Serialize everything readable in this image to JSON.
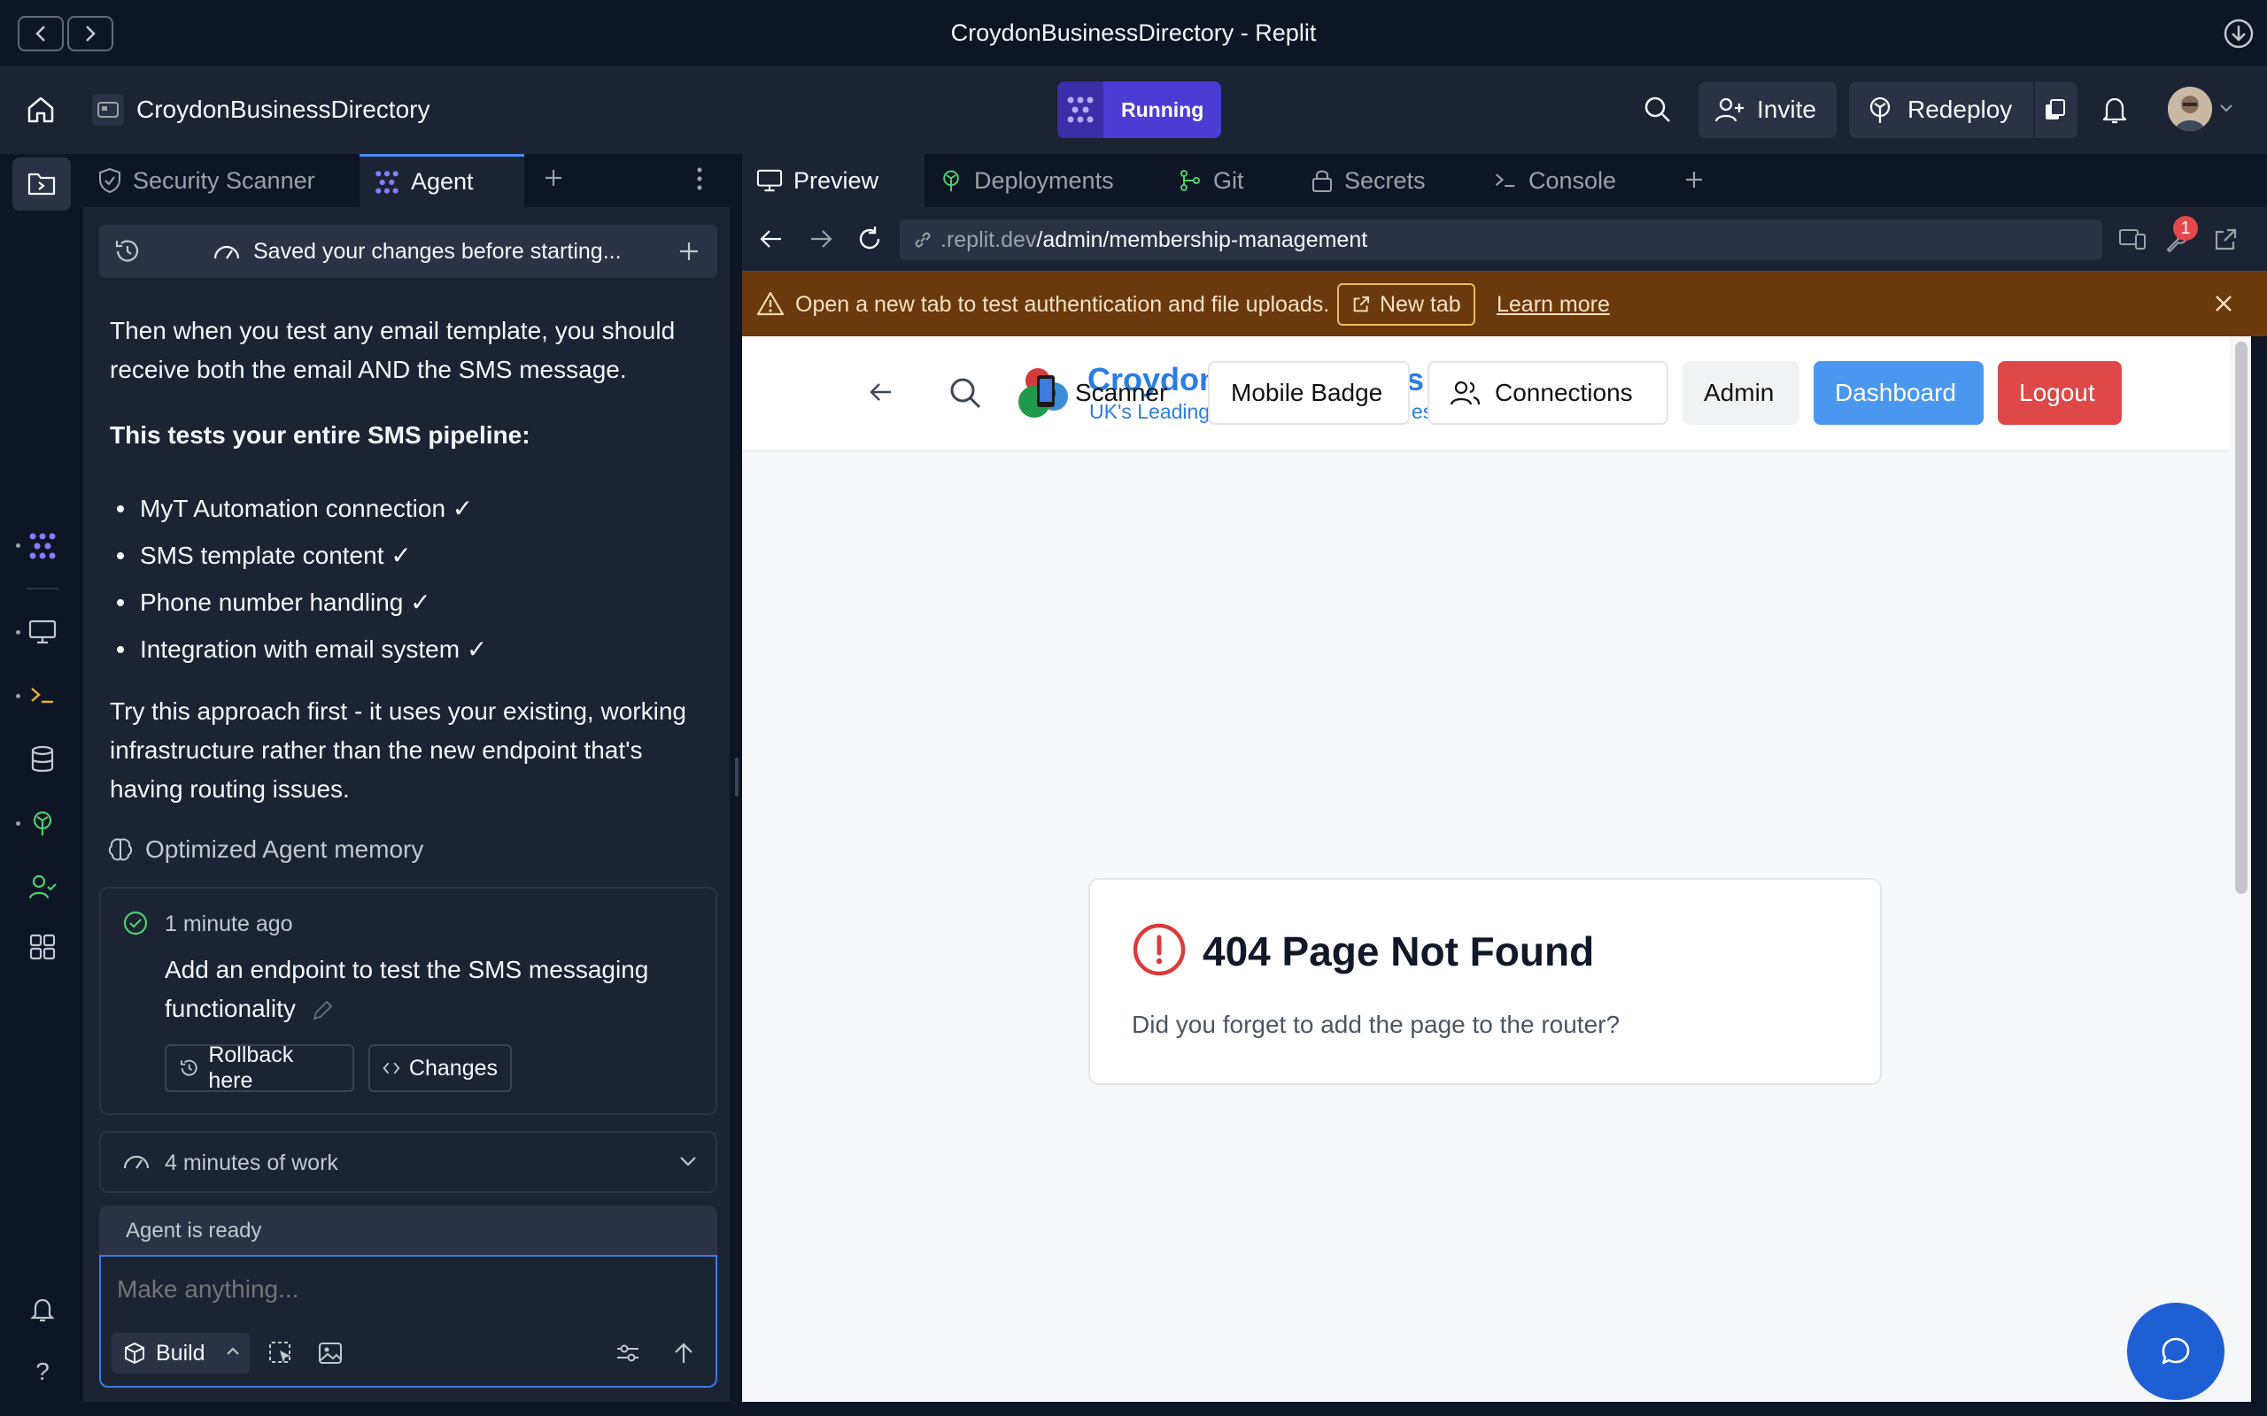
{
  "window": {
    "title": "CroydonBusinessDirectory - Replit"
  },
  "header": {
    "project_name": "CroydonBusinessDirectory",
    "run_status": "Running",
    "invite_label": "Invite",
    "redeploy_label": "Redeploy"
  },
  "left_tabs": [
    {
      "label": "Security Scanner"
    },
    {
      "label": "Agent"
    }
  ],
  "agent": {
    "saved_notice": "Saved your changes before starting...",
    "para1": "Then when you test any email template, you should receive both the email AND the SMS message.",
    "heading": "This tests your entire SMS pipeline:",
    "bullets": [
      "MyT Automation connection ✓",
      "SMS template content ✓",
      "Phone number handling ✓",
      "Integration with email system ✓"
    ],
    "para2": "Try this approach first - it uses your existing, working infrastructure rather than the new endpoint that's having routing issues.",
    "memory_label": "Optimized Agent memory",
    "checkpoint": {
      "time": "1 minute ago",
      "title": "Add an endpoint to test the SMS messaging functionality",
      "rollback_label": "Rollback here",
      "changes_label": "Changes"
    },
    "work_summary": "4 minutes of work",
    "status": "Agent is ready",
    "input_placeholder": "Make anything...",
    "mode_label": "Build"
  },
  "right_tabs": [
    {
      "label": "Preview"
    },
    {
      "label": "Deployments"
    },
    {
      "label": "Git"
    },
    {
      "label": "Secrets"
    },
    {
      "label": "Console"
    }
  ],
  "preview": {
    "url_host": ".replit.dev",
    "url_path": "/admin/membership-management",
    "badge_count": "1",
    "warning_text": "Open a new tab to test authentication and file uploads.",
    "new_tab_label": "New tab",
    "learn_more_label": "Learn more"
  },
  "site": {
    "logo_title": "Croydon",
    "logo_title_tail": "s",
    "logo_subtitle": "UK's Leading",
    "logo_subtitle_tail": "es",
    "scanner_label": "Scanner",
    "nav": {
      "mobile_badge": "Mobile Badge",
      "connections": "Connections",
      "admin": "Admin",
      "dashboard": "Dashboard",
      "logout": "Logout"
    },
    "not_found": {
      "title": "404 Page Not Found",
      "message": "Did you forget to add the page to the router?"
    }
  },
  "colors": {
    "accent_blue": "#4a97f0",
    "logout_red": "#df4848",
    "running_purple": "#4d3cd4",
    "warning_bg": "#6b3a0c",
    "error_red": "#dc3b3b"
  }
}
